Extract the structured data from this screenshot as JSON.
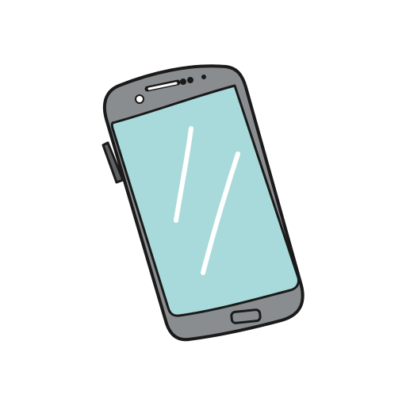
{
  "illustration": {
    "subject": "smartphone-icon",
    "colors": {
      "background": "#ffffff",
      "outline": "#1a1a1a",
      "body": "#8a8d8f",
      "side_button": "#5e6163",
      "screen": "#a8dadc",
      "screen_reflection": "#ffffff",
      "sensor": "#ffffff"
    }
  }
}
